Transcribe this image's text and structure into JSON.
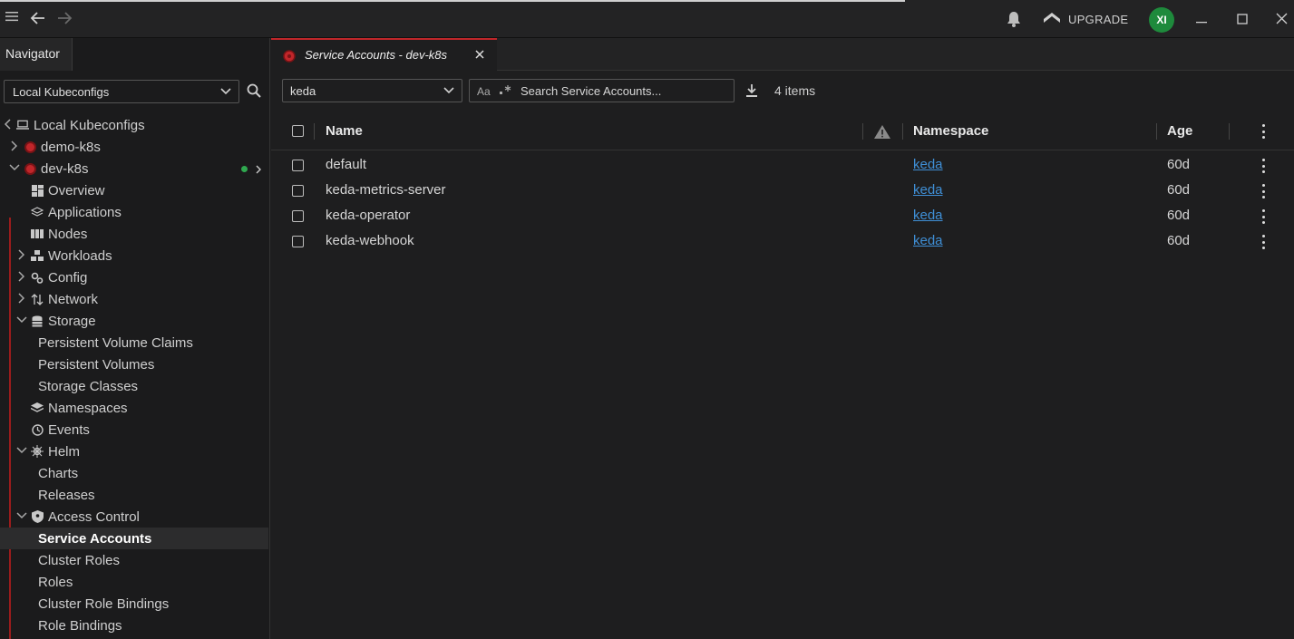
{
  "titlebar": {
    "upgrade_label": "UPGRADE",
    "avatar_initials": "XI"
  },
  "navigator": {
    "tab_label": "Navigator",
    "kubeconfig_select": "Local Kubeconfigs",
    "tree": {
      "root": "Local Kubeconfigs",
      "clusters": [
        "demo-k8s",
        "dev-k8s"
      ],
      "items": [
        {
          "label": "Overview"
        },
        {
          "label": "Applications"
        },
        {
          "label": "Nodes"
        },
        {
          "label": "Workloads"
        },
        {
          "label": "Config"
        },
        {
          "label": "Network"
        },
        {
          "label": "Storage"
        },
        {
          "label": "Persistent Volume Claims"
        },
        {
          "label": "Persistent Volumes"
        },
        {
          "label": "Storage Classes"
        },
        {
          "label": "Namespaces"
        },
        {
          "label": "Events"
        },
        {
          "label": "Helm"
        },
        {
          "label": "Charts"
        },
        {
          "label": "Releases"
        },
        {
          "label": "Access Control"
        },
        {
          "label": "Service Accounts"
        },
        {
          "label": "Cluster Roles"
        },
        {
          "label": "Roles"
        },
        {
          "label": "Cluster Role Bindings"
        },
        {
          "label": "Role Bindings"
        }
      ]
    }
  },
  "main": {
    "tab_title": "Service Accounts - dev-k8s",
    "namespace_select": "keda",
    "search_placeholder": "Search Service Accounts...",
    "search_case_label": "Aa",
    "items_count": "4 items",
    "columns": {
      "name": "Name",
      "namespace": "Namespace",
      "age": "Age"
    },
    "rows": [
      {
        "name": "default",
        "namespace": "keda",
        "age": "60d"
      },
      {
        "name": "keda-metrics-server",
        "namespace": "keda",
        "age": "60d"
      },
      {
        "name": "keda-operator",
        "namespace": "keda",
        "age": "60d"
      },
      {
        "name": "keda-webhook",
        "namespace": "keda",
        "age": "60d"
      }
    ]
  },
  "colors": {
    "accent_red": "#c0262a",
    "link_blue": "#3f8fd6",
    "status_green": "#2fa84f",
    "avatar_green": "#1e8a3c"
  }
}
